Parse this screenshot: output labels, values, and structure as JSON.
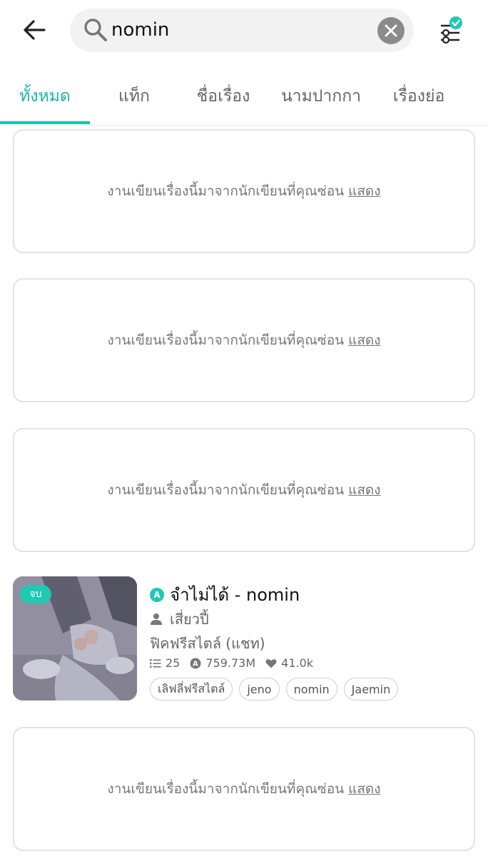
{
  "search": {
    "query": "nomin"
  },
  "tabs": [
    {
      "label": "ทั้งหมด",
      "active": true
    },
    {
      "label": "แท็ก",
      "active": false
    },
    {
      "label": "ชื่อเรื่อง",
      "active": false
    },
    {
      "label": "นามปากกา",
      "active": false
    },
    {
      "label": "เรื่องย่อ",
      "active": false
    }
  ],
  "hidden_notice": {
    "text": "งานเขียนเรื่องนี้มาจากนักเขียนที่คุณซ่อน",
    "show_link": "แสดง"
  },
  "story": {
    "status_badge": "จบ",
    "title": "จำไม่ได้ - nomin",
    "author": "เสี่ยวปี้",
    "category": "ฟิคฟรีสไตล์ (แชท)",
    "chapters": "25",
    "views": "759.73M",
    "likes": "41.0k",
    "tags": [
      "เลิฟลี่ฟรีสไตล์",
      "jeno",
      "nomin",
      "Jaemin"
    ]
  },
  "icons": {
    "back": "arrow-left-icon",
    "search": "search-icon",
    "clear": "close-circle-icon",
    "filter": "filter-sliders-check-icon",
    "author": "user-icon",
    "chapters": "list-icon",
    "views": "view-count-icon",
    "likes": "heart-icon"
  },
  "colors": {
    "accent": "#17c2b0",
    "text_muted": "#777777",
    "card_border": "#e3e3e3"
  }
}
